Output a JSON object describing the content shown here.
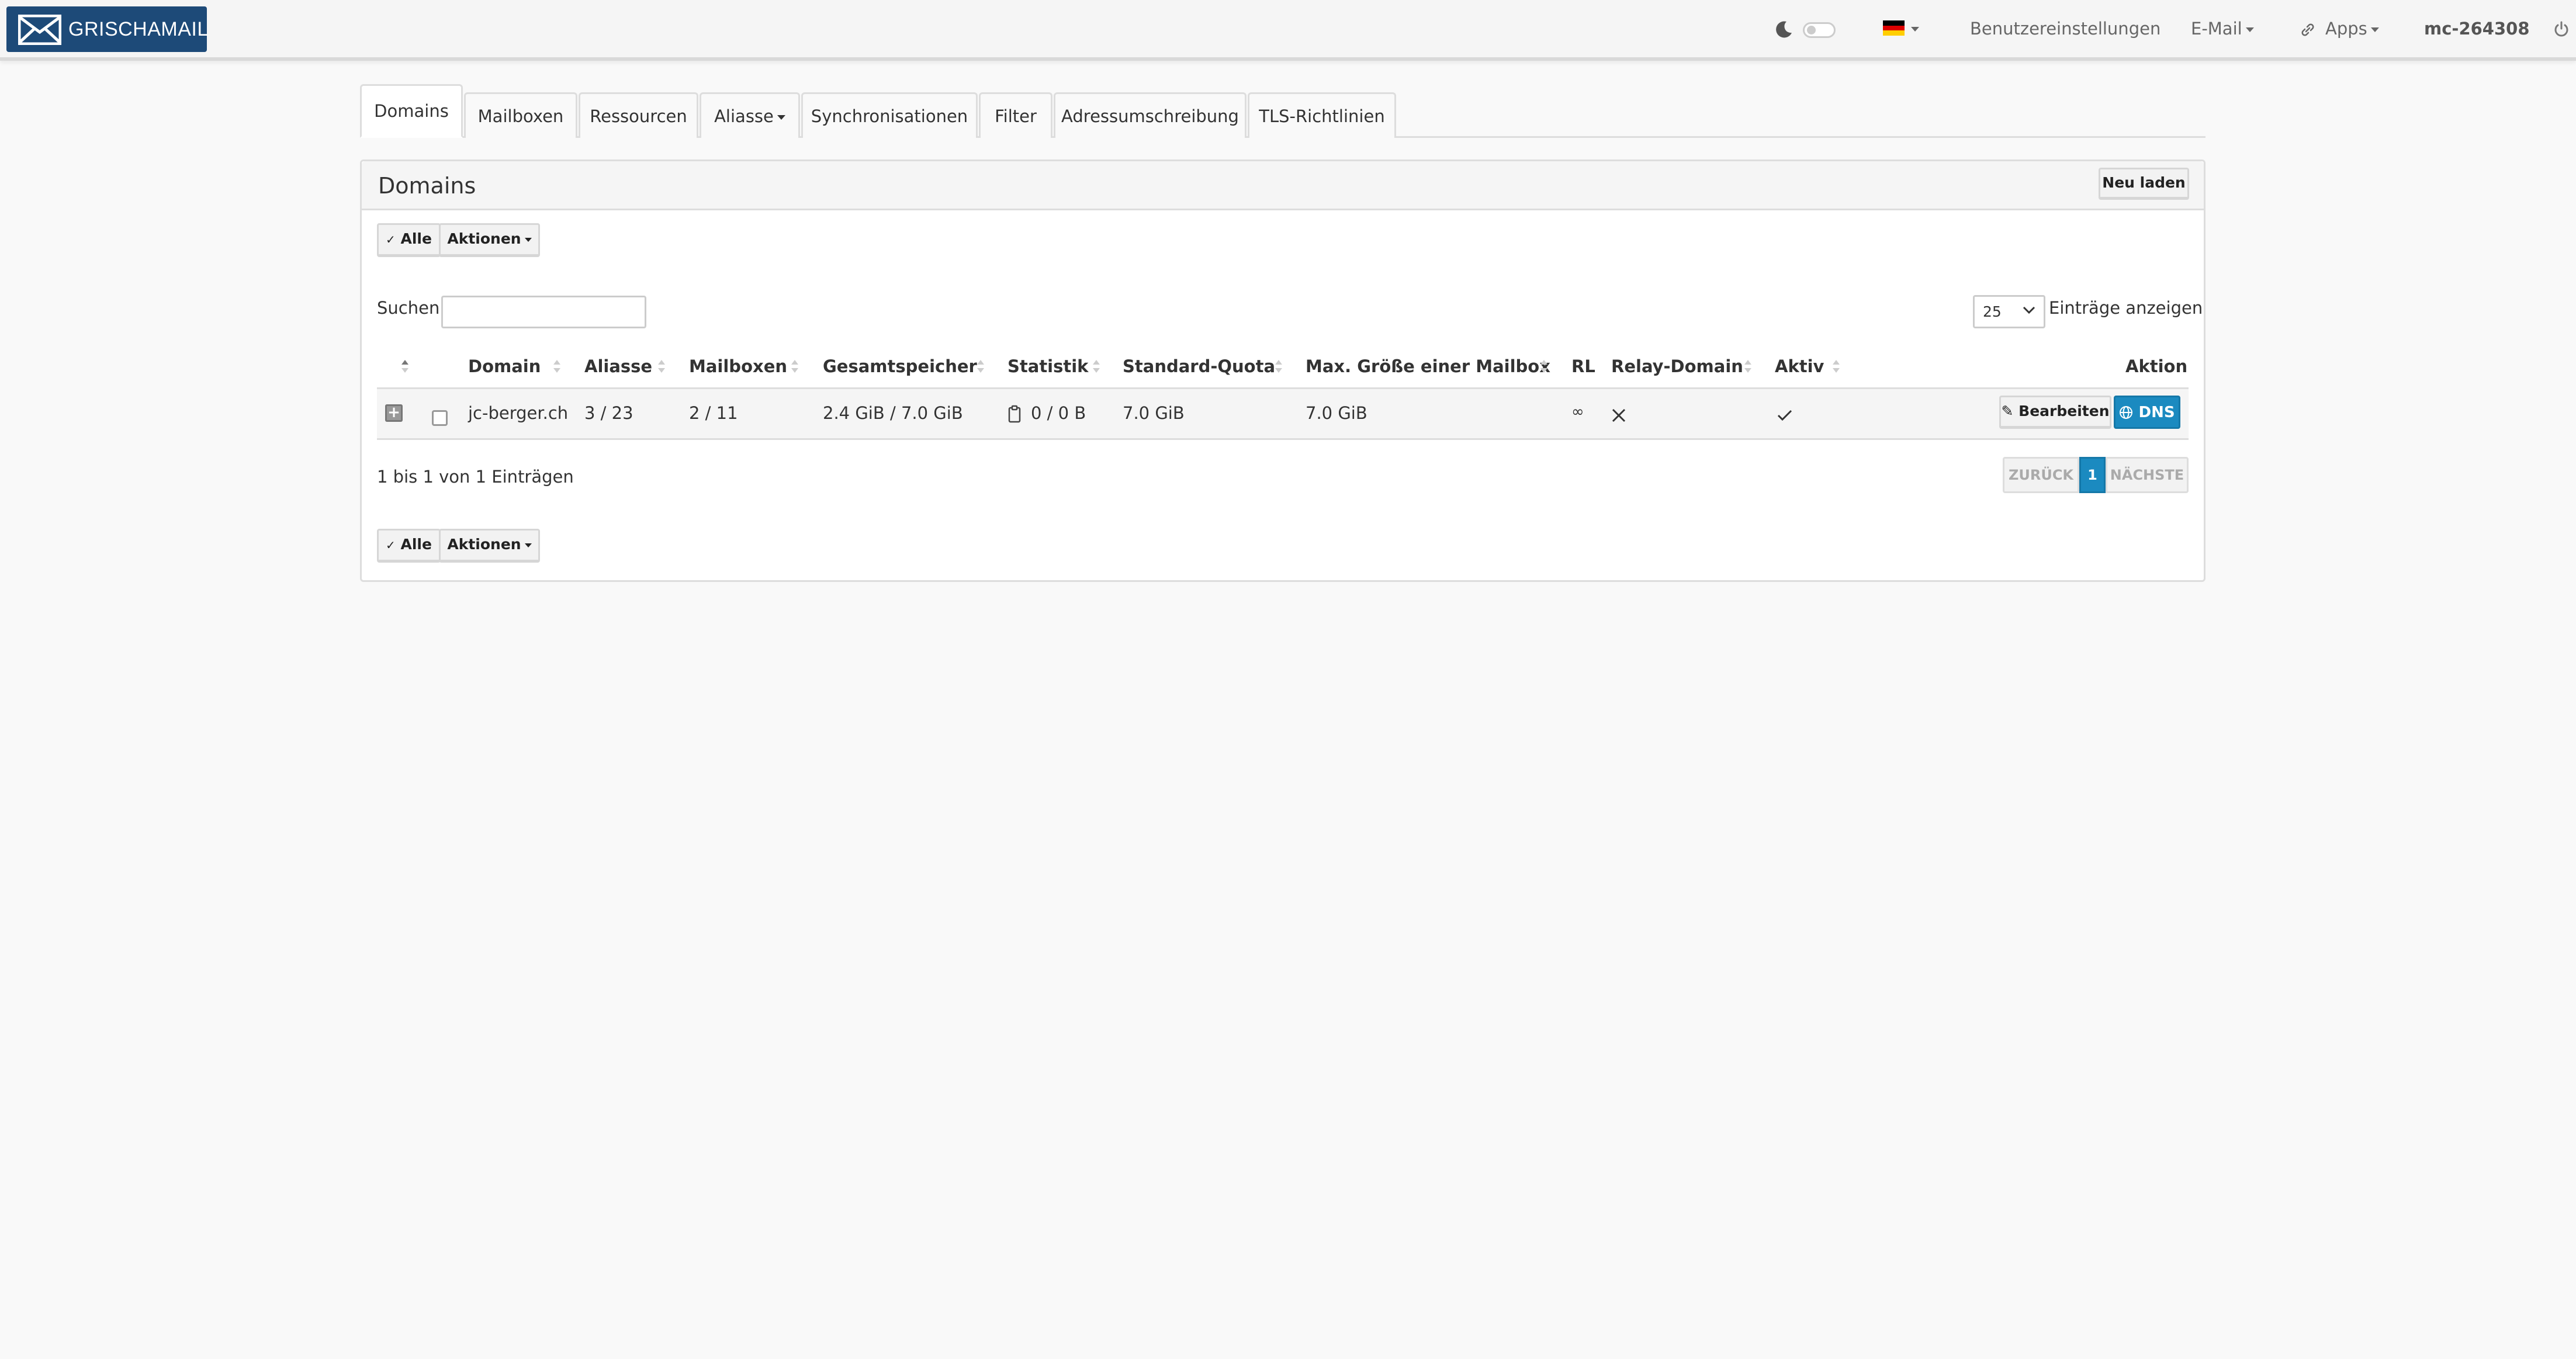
{
  "brand": {
    "logo_text": "GRISCHAMAIL"
  },
  "navbar": {
    "user_settings": "Benutzereinstellungen",
    "email_menu": "E-Mail",
    "apps_menu": "Apps",
    "username": "mc-264308",
    "language": "de"
  },
  "tabs": [
    {
      "label": "Domains",
      "active": true
    },
    {
      "label": "Mailboxen"
    },
    {
      "label": "Ressourcen"
    },
    {
      "label": "Aliasse",
      "dropdown": true
    },
    {
      "label": "Synchronisationen"
    },
    {
      "label": "Filter"
    },
    {
      "label": "Adressumschreibung"
    },
    {
      "label": "TLS-Richtlinien"
    }
  ],
  "panel": {
    "title": "Domains",
    "reload_button": "Neu laden",
    "select_all": "Alle",
    "actions": "Aktionen",
    "search_label": "Suchen",
    "search_value": "",
    "page_length": "25",
    "page_length_label": "Einträge anzeigen"
  },
  "table": {
    "columns": [
      "Domain",
      "Aliasse",
      "Mailboxen",
      "Gesamtspeicher",
      "Statistik",
      "Standard-Quota",
      "Max. Größe einer Mailbox",
      "RL",
      "Relay-Domain",
      "Aktiv",
      "Aktion"
    ],
    "rows": [
      {
        "domain": "jc-berger.ch",
        "aliases": "3 / 23",
        "mailboxes": "2 / 11",
        "storage": "2.4 GiB / 7.0 GiB",
        "statistics": "0 / 0 B",
        "default_quota": "7.0 GiB",
        "max_mailbox_size": "7.0 GiB",
        "rl": "∞",
        "relay_domain": false,
        "active": true,
        "edit_button": "Bearbeiten",
        "dns_button": "DNS"
      }
    ],
    "info": "1 bis 1 von 1 Einträgen",
    "pagination": {
      "prev": "ZURÜCK",
      "current": "1",
      "next": "NÄCHSTE"
    }
  },
  "colors": {
    "brand": "#1d4a78",
    "accent": "#1b8ac0",
    "flag": [
      "#000000",
      "#dd0000",
      "#ffce00"
    ]
  },
  "icons": [
    "mail-envelope-icon",
    "moon-icon",
    "chevron-down-icon",
    "link-icon",
    "power-icon",
    "check-icon",
    "pencil-icon",
    "globe-icon",
    "clipboard-icon",
    "x-icon",
    "checkmark-icon"
  ]
}
